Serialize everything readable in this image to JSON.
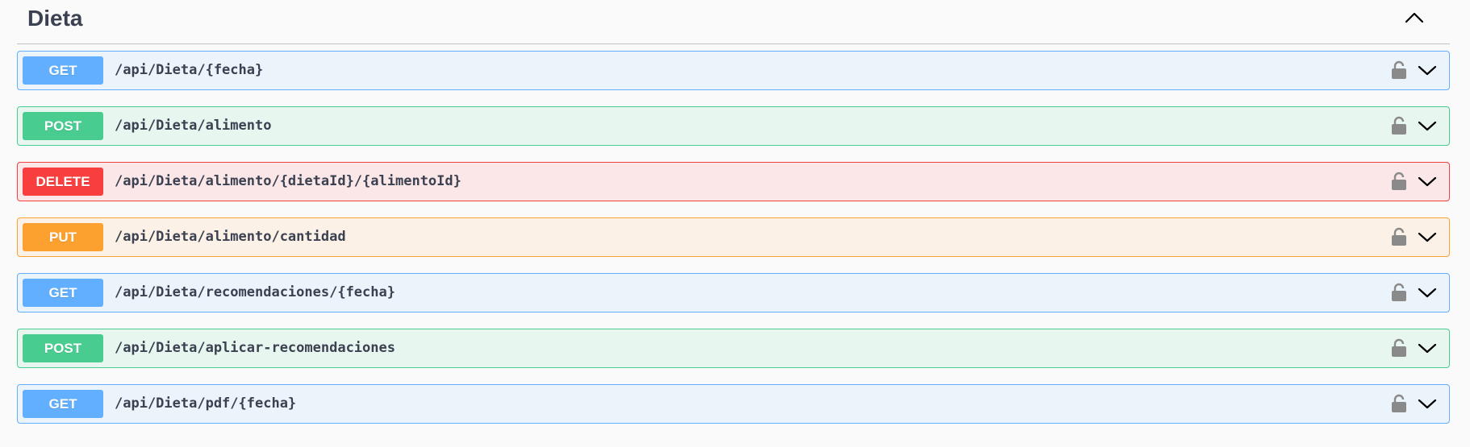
{
  "section": {
    "title": "Dieta",
    "collapse_icon": "chevron-up-icon"
  },
  "operations": [
    {
      "method": "GET",
      "path": "/api/Dieta/{fecha}",
      "lock_icon": "lock-icon",
      "expand_icon": "chevron-down-icon"
    },
    {
      "method": "POST",
      "path": "/api/Dieta/alimento",
      "lock_icon": "lock-icon",
      "expand_icon": "chevron-down-icon"
    },
    {
      "method": "DELETE",
      "path": "/api/Dieta/alimento/{dietaId}/{alimentoId}",
      "lock_icon": "lock-icon",
      "expand_icon": "chevron-down-icon"
    },
    {
      "method": "PUT",
      "path": "/api/Dieta/alimento/cantidad",
      "lock_icon": "lock-icon",
      "expand_icon": "chevron-down-icon"
    },
    {
      "method": "GET",
      "path": "/api/Dieta/recomendaciones/{fecha}",
      "lock_icon": "lock-icon",
      "expand_icon": "chevron-down-icon"
    },
    {
      "method": "POST",
      "path": "/api/Dieta/aplicar-recomendaciones",
      "lock_icon": "lock-icon",
      "expand_icon": "chevron-down-icon"
    },
    {
      "method": "GET",
      "path": "/api/Dieta/pdf/{fecha}",
      "lock_icon": "lock-icon",
      "expand_icon": "chevron-down-icon"
    }
  ],
  "colors": {
    "get": "#61affe",
    "post": "#49cc90",
    "delete": "#f93e3e",
    "put": "#fca130",
    "text": "#3b4151"
  }
}
